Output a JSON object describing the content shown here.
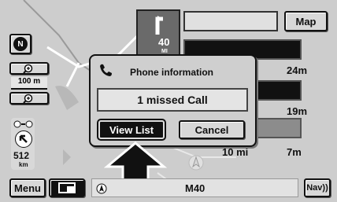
{
  "map": {
    "button_label": "Map",
    "scale_label": "100 m",
    "distance_value": "512",
    "distance_unit": "km"
  },
  "turn_panel": {
    "distance": "40",
    "unit": "MI"
  },
  "route_list": {
    "rows": [
      {
        "distance": "24m"
      },
      {
        "distance": "19m"
      },
      {
        "distance_partial": "10 mi",
        "distance": "7m"
      }
    ]
  },
  "dialog": {
    "title": "Phone information",
    "message": "1 missed Call",
    "view_list_label": "View List",
    "cancel_label": "Cancel"
  },
  "bottom_bar": {
    "menu_label": "Menu",
    "road_name": "M40",
    "nav_label": "Nav))"
  },
  "compass_letter": "N"
}
